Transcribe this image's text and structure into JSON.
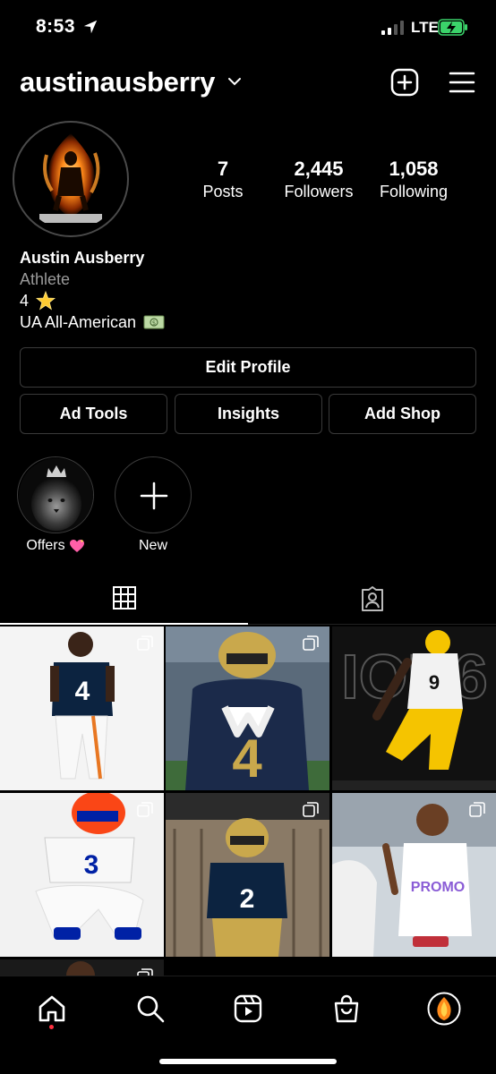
{
  "status_bar": {
    "time": "8:53",
    "network": "LTE"
  },
  "profile": {
    "username": "austinausberry",
    "stats": [
      {
        "num": "7",
        "label": "Posts"
      },
      {
        "num": "2,445",
        "label": "Followers"
      },
      {
        "num": "1,058",
        "label": "Following"
      }
    ],
    "bio": {
      "name": "Austin Ausberry",
      "category": "Athlete",
      "line1": "4",
      "line2": "UA All-American"
    }
  },
  "buttons": {
    "edit_profile": "Edit Profile",
    "ad_tools": "Ad Tools",
    "insights": "Insights",
    "add_shop": "Add Shop"
  },
  "highlights": [
    {
      "label": "Offers",
      "icon": "heart-emoji"
    },
    {
      "label": "New",
      "icon": "plus-icon"
    }
  ],
  "tabs": [
    {
      "name": "posts-grid",
      "icon": "grid-icon",
      "active": true
    },
    {
      "name": "tagged",
      "icon": "tagged-person-icon",
      "active": false
    }
  ],
  "grid_posts": [
    {
      "desc": "Auburn uniform",
      "multiple": true,
      "colors": [
        "#f4f4f4",
        "#0c2340",
        "#e87722"
      ]
    },
    {
      "desc": "Notre Dame navy #4",
      "multiple": true,
      "colors": [
        "#2a3d5a",
        "#1b2a4a",
        "#c9a84c"
      ]
    },
    {
      "desc": "Iowa black and gold",
      "multiple": false,
      "colors": [
        "#111111",
        "#f5c400",
        "#eeeeee"
      ]
    },
    {
      "desc": "Florida #3",
      "multiple": true,
      "colors": [
        "#f2f2f2",
        "#fa4616",
        "#0021a5"
      ]
    },
    {
      "desc": "Notre Dame locker",
      "multiple": true,
      "colors": [
        "#8a7a66",
        "#0c2340",
        "#c9a84c"
      ]
    },
    {
      "desc": "White uniform",
      "multiple": true,
      "colors": [
        "#e9ecef",
        "#ffffff",
        "#7a4a2a"
      ]
    }
  ],
  "nav": [
    {
      "name": "home",
      "icon": "home-icon",
      "active": true
    },
    {
      "name": "search",
      "icon": "search-icon"
    },
    {
      "name": "reels",
      "icon": "reels-icon"
    },
    {
      "name": "shop",
      "icon": "shopping-bag-icon"
    },
    {
      "name": "profile",
      "icon": "profile-avatar"
    }
  ],
  "colors": {
    "background": "#000000",
    "accent_dot": "#ff3040",
    "secondary_text": "#9a9a9a",
    "border": "#3a3a3a"
  }
}
